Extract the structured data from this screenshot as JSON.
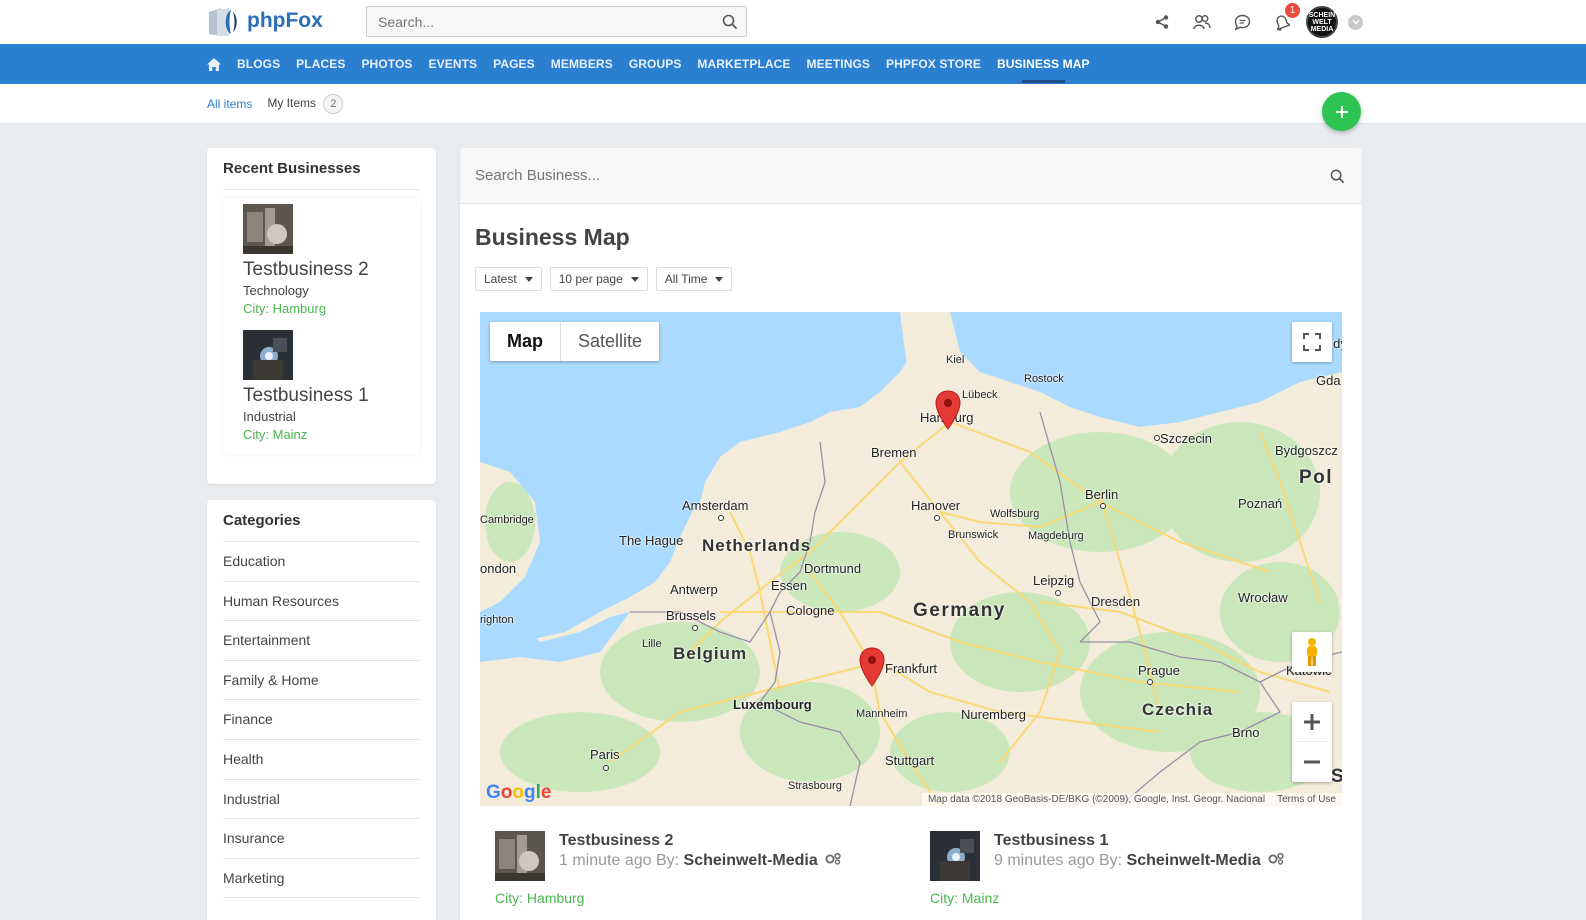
{
  "header": {
    "logo_text": "phpFox",
    "search_placeholder": "Search...",
    "notification_count": "1",
    "avatar_text": "SCHEIN WELT MEDIA"
  },
  "nav": {
    "items": [
      "BLOGS",
      "PLACES",
      "PHOTOS",
      "EVENTS",
      "PAGES",
      "MEMBERS",
      "GROUPS",
      "MARKETPLACE",
      "MEETINGS",
      "PHPFOX STORE",
      "BUSINESS MAP"
    ],
    "active": "BUSINESS MAP"
  },
  "subnav": {
    "all_items": "All items",
    "my_items": "My Items",
    "my_items_count": "2"
  },
  "recent": {
    "title": "Recent Businesses",
    "items": [
      {
        "name": "Testbusiness 2",
        "category": "Technology",
        "city": "City: Hamburg"
      },
      {
        "name": "Testbusiness 1",
        "category": "Industrial",
        "city": "City: Mainz"
      }
    ]
  },
  "categories": {
    "title": "Categories",
    "items": [
      "Education",
      "Human Resources",
      "Entertainment",
      "Family & Home",
      "Finance",
      "Health",
      "Industrial",
      "Insurance",
      "Marketing"
    ]
  },
  "main": {
    "search_placeholder": "Search Business...",
    "title": "Business Map",
    "filters": [
      "Latest",
      "10 per page",
      "All Time"
    ]
  },
  "map": {
    "type_map": "Map",
    "type_satellite": "Satellite",
    "google": "Google",
    "attribution": "Map data ©2018 GeoBasis-DE/BKG (©2009), Google, Inst. Geogr. Nacional",
    "terms": "Terms of Use",
    "colors": {
      "water": "#aadaff",
      "land": "#f3ecda",
      "green": "#c6e7b8",
      "road": "#fcd870"
    },
    "labels": {
      "kiel": "Kiel",
      "lubeck": "Lübeck",
      "rostock": "Rostock",
      "hamburg": "Hamburg",
      "szczecin": "Szczecin",
      "bydgoszcz": "Bydgoszcz",
      "gda": "Gda",
      "gdy": "Gdy",
      "pol": "Pol",
      "bremen": "Bremen",
      "berlin": "Berlin",
      "poznan": "Poznań",
      "amsterdam": "Amsterdam",
      "hanover": "Hanover",
      "wolfsburg": "Wolfsburg",
      "cambridge": "Cambridge",
      "brunswick": "Brunswick",
      "magdeburg": "Magdeburg",
      "the_hague": "The Hague",
      "netherlands": "Netherlands",
      "london": "ondon",
      "dortmund": "Dortmund",
      "leipzig": "Leipzig",
      "antwerp": "Antwerp",
      "essen": "Essen",
      "germany": "Germany",
      "dresden": "Dresden",
      "wroclaw": "Wrocław",
      "brussels": "Brussels",
      "cologne": "Cologne",
      "brighton": "righton",
      "lille": "Lille",
      "belgium": "Belgium",
      "frankfurt": "Frankfurt",
      "prague": "Prague",
      "katowice": "Katowic",
      "luxembourg": "Luxembourg",
      "mannheim": "Mannheim",
      "nuremberg": "Nuremberg",
      "czechia": "Czechia",
      "brno": "Brno",
      "paris": "Paris",
      "stuttgart": "Stuttgart",
      "strasbourg": "Strasbourg",
      "s": "S"
    }
  },
  "results": [
    {
      "name": "Testbusiness 2",
      "time": "1 minute ago By: ",
      "author": "Scheinwelt-Media",
      "city": "City: Hamburg"
    },
    {
      "name": "Testbusiness 1",
      "time": "9 minutes ago By: ",
      "author": "Scheinwelt-Media",
      "city": "City: Mainz"
    }
  ]
}
